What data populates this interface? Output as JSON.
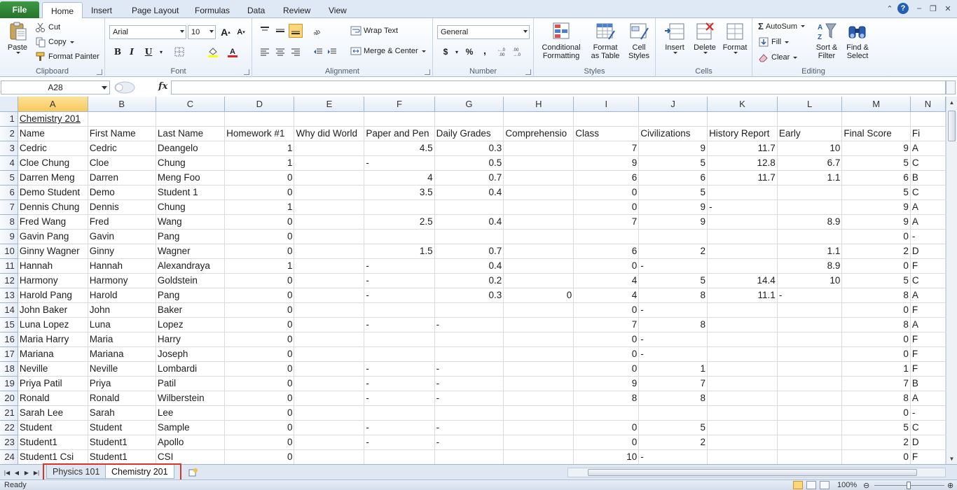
{
  "tabs": {
    "file": "File",
    "items": [
      "Home",
      "Insert",
      "Page Layout",
      "Formulas",
      "Data",
      "Review",
      "View"
    ],
    "active": "Home"
  },
  "ribbon": {
    "clipboard": {
      "label": "Clipboard",
      "paste": "Paste",
      "cut": "Cut",
      "copy": "Copy",
      "format_painter": "Format Painter"
    },
    "font": {
      "label": "Font",
      "name": "Arial",
      "size": "10",
      "bold": "B",
      "italic": "I",
      "underline": "U"
    },
    "alignment": {
      "label": "Alignment",
      "wrap_text": "Wrap Text",
      "merge_center": "Merge & Center"
    },
    "number": {
      "label": "Number",
      "format": "General",
      "currency": "$",
      "percent": "%",
      "comma": ","
    },
    "styles": {
      "label": "Styles",
      "conditional": "Conditional",
      "conditional2": "Formatting",
      "format_table": "Format",
      "format_table2": "as Table",
      "cell_styles": "Cell",
      "cell_styles2": "Styles"
    },
    "cells": {
      "label": "Cells",
      "insert": "Insert",
      "delete": "Delete",
      "format": "Format"
    },
    "editing": {
      "label": "Editing",
      "autosum": "AutoSum",
      "fill": "Fill",
      "clear": "Clear",
      "sort": "Sort &",
      "sort2": "Filter",
      "find": "Find &",
      "find2": "Select"
    }
  },
  "formula_bar": {
    "name_box": "A28",
    "fx": "fx",
    "value": ""
  },
  "grid": {
    "columns": [
      "A",
      "B",
      "C",
      "D",
      "E",
      "F",
      "G",
      "H",
      "I",
      "J",
      "K",
      "L",
      "M",
      "N"
    ],
    "active_column": "A",
    "rows": [
      {
        "n": "1",
        "cells": [
          "Chemistry 201",
          "",
          "",
          "",
          "",
          "",
          "",
          "",
          "",
          "",
          "",
          "",
          "",
          ""
        ]
      },
      {
        "n": "2",
        "cells": [
          "Name",
          "First Name",
          "Last Name",
          "Homework #1",
          "Why did World",
          "Paper and Pen",
          "Daily Grades",
          "Comprehensio",
          "Class",
          "Civilizations",
          "History Report",
          "Early",
          "Final Score",
          "Fi"
        ]
      },
      {
        "n": "3",
        "cells": [
          "Cedric",
          "Cedric",
          "Deangelo",
          "1",
          "",
          "4.5",
          "0.3",
          "",
          "7",
          "9",
          "11.7",
          "10",
          "9",
          "A"
        ]
      },
      {
        "n": "4",
        "cells": [
          "Cloe Chung",
          "Cloe",
          "Chung",
          "1",
          "",
          "-",
          "0.5",
          "",
          "9",
          "5",
          "12.8",
          "6.7",
          "5",
          "C"
        ]
      },
      {
        "n": "5",
        "cells": [
          "Darren Meng",
          "Darren",
          "Meng Foo",
          "0",
          "",
          "4",
          "0.7",
          "",
          "6",
          "6",
          "11.7",
          "1.1",
          "6",
          "B"
        ]
      },
      {
        "n": "6",
        "cells": [
          "Demo Student",
          "Demo",
          "Student 1",
          "0",
          "",
          "3.5",
          "0.4",
          "",
          "0",
          "5",
          "",
          "",
          "5",
          "C"
        ]
      },
      {
        "n": "7",
        "cells": [
          "Dennis Chung",
          "Dennis",
          "Chung",
          "1",
          "",
          "",
          "",
          "",
          "0",
          "9",
          "-",
          "",
          "9",
          "A"
        ]
      },
      {
        "n": "8",
        "cells": [
          "Fred Wang",
          "Fred",
          "Wang",
          "0",
          "",
          "2.5",
          "0.4",
          "",
          "7",
          "9",
          "",
          "8.9",
          "9",
          "A"
        ]
      },
      {
        "n": "9",
        "cells": [
          "Gavin Pang",
          "Gavin",
          "Pang",
          "0",
          "",
          "",
          "",
          "",
          "",
          "",
          "",
          "",
          "0",
          "-"
        ]
      },
      {
        "n": "10",
        "cells": [
          "Ginny Wagner",
          "Ginny",
          "Wagner",
          "0",
          "",
          "1.5",
          "0.7",
          "",
          "6",
          "2",
          "",
          "1.1",
          "2",
          "D"
        ]
      },
      {
        "n": "11",
        "cells": [
          "Hannah",
          "Hannah",
          "Alexandraya",
          "1",
          "",
          "-",
          "0.4",
          "",
          "0",
          "-",
          "",
          "8.9",
          "0",
          "F"
        ]
      },
      {
        "n": "12",
        "cells": [
          "Harmony",
          "Harmony",
          "Goldstein",
          "0",
          "",
          "-",
          "0.2",
          "",
          "4",
          "5",
          "14.4",
          "10",
          "5",
          "C"
        ]
      },
      {
        "n": "13",
        "cells": [
          "Harold Pang",
          "Harold",
          "Pang",
          "0",
          "",
          "-",
          "0.3",
          "0",
          "4",
          "8",
          "11.1",
          "-",
          "8",
          "A"
        ]
      },
      {
        "n": "14",
        "cells": [
          "John Baker",
          "John",
          "Baker",
          "0",
          "",
          "",
          "",
          "",
          "0",
          "-",
          "",
          "",
          "0",
          "F"
        ]
      },
      {
        "n": "15",
        "cells": [
          "Luna Lopez",
          "Luna",
          "Lopez",
          "0",
          "",
          "-",
          "-",
          "",
          "7",
          "8",
          "",
          "",
          "8",
          "A"
        ]
      },
      {
        "n": "16",
        "cells": [
          "Maria Harry",
          "Maria",
          "Harry",
          "0",
          "",
          "",
          "",
          "",
          "0",
          "-",
          "",
          "",
          "0",
          "F"
        ]
      },
      {
        "n": "17",
        "cells": [
          "Mariana",
          "Mariana",
          "Joseph",
          "0",
          "",
          "",
          "",
          "",
          "0",
          "-",
          "",
          "",
          "0",
          "F"
        ]
      },
      {
        "n": "18",
        "cells": [
          "Neville",
          "Neville",
          "Lombardi",
          "0",
          "",
          "-",
          "-",
          "",
          "0",
          "1",
          "",
          "",
          "1",
          "F"
        ]
      },
      {
        "n": "19",
        "cells": [
          "Priya Patil",
          "Priya",
          "Patil",
          "0",
          "",
          "-",
          "-",
          "",
          "9",
          "7",
          "",
          "",
          "7",
          "B"
        ]
      },
      {
        "n": "20",
        "cells": [
          "Ronald",
          "Ronald",
          "Wilberstein",
          "0",
          "",
          "-",
          "-",
          "",
          "8",
          "8",
          "",
          "",
          "8",
          "A"
        ]
      },
      {
        "n": "21",
        "cells": [
          "Sarah Lee",
          "Sarah",
          "Lee",
          "0",
          "",
          "",
          "",
          "",
          "",
          "",
          "",
          "",
          "0",
          "-"
        ]
      },
      {
        "n": "22",
        "cells": [
          "Student",
          "Student",
          "Sample",
          "0",
          "",
          "-",
          "-",
          "",
          "0",
          "5",
          "",
          "",
          "5",
          "C"
        ]
      },
      {
        "n": "23",
        "cells": [
          "Student1",
          "Student1",
          "Apollo",
          "0",
          "",
          "-",
          "-",
          "",
          "0",
          "2",
          "",
          "",
          "2",
          "D"
        ]
      },
      {
        "n": "24",
        "cells": [
          "Student1 Csi",
          "Student1",
          "CSI",
          "0",
          "",
          "",
          "",
          "",
          "10",
          "-",
          "",
          "",
          "0",
          "F"
        ]
      }
    ]
  },
  "sheets": {
    "items": [
      "Physics 101",
      "Chemistry 201"
    ],
    "active": "Chemistry 201"
  },
  "status": {
    "text": "Ready",
    "zoom": "100%"
  }
}
